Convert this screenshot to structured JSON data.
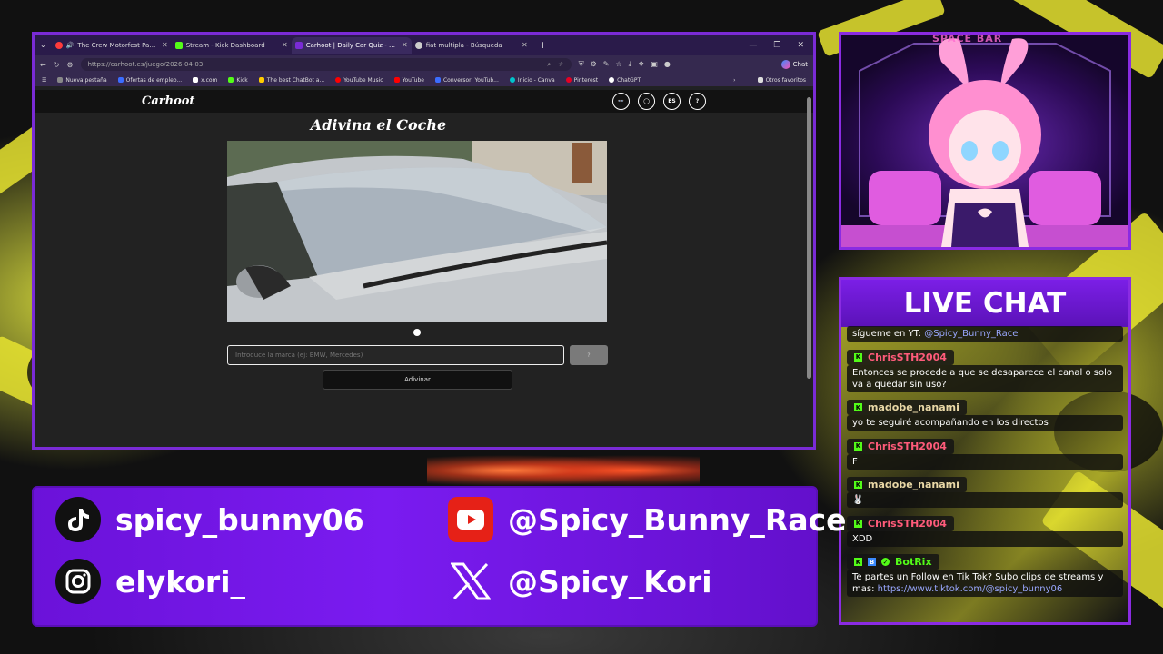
{
  "browser": {
    "tabs": [
      {
        "title": "The Crew Motorfest Pause M",
        "color": "#ff3b3b"
      },
      {
        "title": "Stream - Kick Dashboard",
        "color": "#53fc18"
      },
      {
        "title": "Carhoot | Daily Car Quiz - Guess th",
        "color": "#7a2bd6"
      },
      {
        "title": "fiat multipla - Búsqueda",
        "color": "#cccccc"
      }
    ],
    "url": "https://carhoot.es/juego/2026-04-03",
    "chat_button": "Chat",
    "bookmarks": [
      {
        "label": "Nueva pestaña",
        "color": "#888888"
      },
      {
        "label": "Ofertas de empleo...",
        "color": "#3b6dff"
      },
      {
        "label": "x.com",
        "color": "#ffffff"
      },
      {
        "label": "Kick",
        "color": "#53fc18"
      },
      {
        "label": "The best ChatBot a...",
        "color": "#ffcc00"
      },
      {
        "label": "YouTube Music",
        "color": "#ff0000"
      },
      {
        "label": "YouTube",
        "color": "#ff0000"
      },
      {
        "label": "Conversor: YouTub...",
        "color": "#3b6dff"
      },
      {
        "label": "Inicio - Canva",
        "color": "#00c4cc"
      },
      {
        "label": "Pinterest",
        "color": "#e60023"
      },
      {
        "label": "ChatGPT",
        "color": "#ffffff"
      }
    ],
    "other_bookmarks": "Otros favoritos"
  },
  "carhoot": {
    "logo": "Carhoot",
    "nav": [
      "👓",
      "◯",
      "ES",
      "?"
    ],
    "title": "Adivina el Coche",
    "input_placeholder": "Introduce la marca (ej: BMW, Mercedes)",
    "small_button": "?",
    "submit_label": "Adivinar"
  },
  "cam": {
    "sign": "SPACE BAR"
  },
  "chat": {
    "header": "LIVE CHAT",
    "pinned_prefix": "sígueme en YT: ",
    "pinned_handle": "@Spicy_Bunny_Race",
    "messages": [
      {
        "user": "ChrisSTH2004",
        "color": "#ff5b7a",
        "text": "Entonces se procede a que se desaparece el canal o solo va a quedar sin uso?"
      },
      {
        "user": "madobe_nanami",
        "color": "#e9d8a6",
        "text": "yo te seguiré acompañando en los directos"
      },
      {
        "user": "ChrisSTH2004",
        "color": "#ff5b7a",
        "text": "F"
      },
      {
        "user": "madobe_nanami",
        "color": "#e9d8a6",
        "text": "🐰"
      },
      {
        "user": "ChrisSTH2004",
        "color": "#ff5b7a",
        "text": "XDD"
      },
      {
        "user": "BotRix",
        "color": "#53fc18",
        "text": "Te partes un Follow en Tik Tok? Subo clips de streams y mas: ",
        "link": "https://www.tiktok.com/@spicy_bunny06"
      }
    ]
  },
  "socials": {
    "tiktok": "spicy_bunny06",
    "youtube": "@Spicy_Bunny_Race",
    "instagram": "elykori_",
    "x": "@Spicy_Kori"
  }
}
